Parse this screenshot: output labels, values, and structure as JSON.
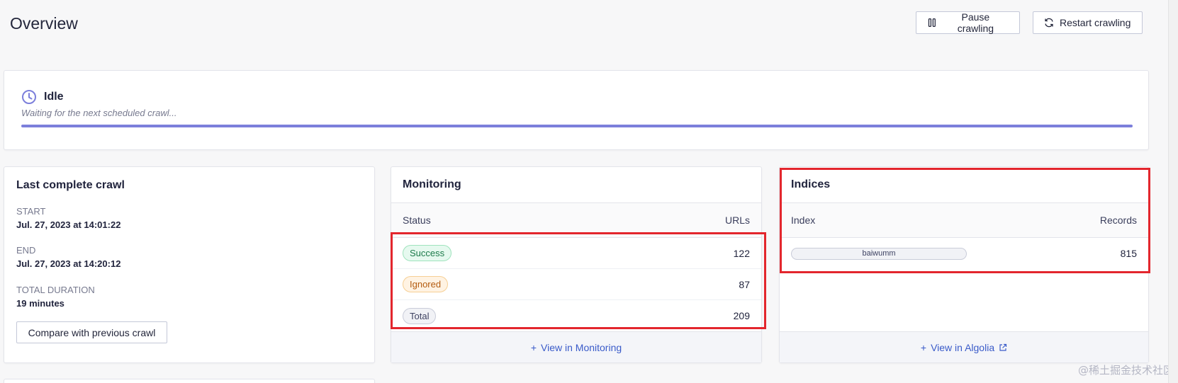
{
  "header": {
    "title": "Overview",
    "pause_label": "Pause crawling",
    "restart_label": "Restart crawling"
  },
  "status": {
    "title": "Idle",
    "description": "Waiting for the next scheduled crawl...",
    "progress": 1.0
  },
  "last_crawl": {
    "title": "Last complete crawl",
    "start_label": "START",
    "start_value": "Jul. 27, 2023 at 14:01:22",
    "end_label": "END",
    "end_value": "Jul. 27, 2023 at 14:20:12",
    "duration_label": "TOTAL DURATION",
    "duration_value": "19 minutes",
    "compare_label": "Compare with previous crawl"
  },
  "monitoring": {
    "title": "Monitoring",
    "col_status": "Status",
    "col_urls": "URLs",
    "rows": [
      {
        "status": "Success",
        "urls": "122"
      },
      {
        "status": "Ignored",
        "urls": "87"
      },
      {
        "status": "Total",
        "urls": "209"
      }
    ],
    "footer_link": "View in Monitoring"
  },
  "indices": {
    "title": "Indices",
    "col_index": "Index",
    "col_records": "Records",
    "rows": [
      {
        "index": "baiwumm",
        "records": "815"
      }
    ],
    "footer_link": "View in Algolia"
  },
  "watermark": "@稀土掘金技术社区",
  "colors": {
    "accent": "#7c7fdb",
    "link": "#3a5bc9",
    "highlight": "#e3262d"
  }
}
